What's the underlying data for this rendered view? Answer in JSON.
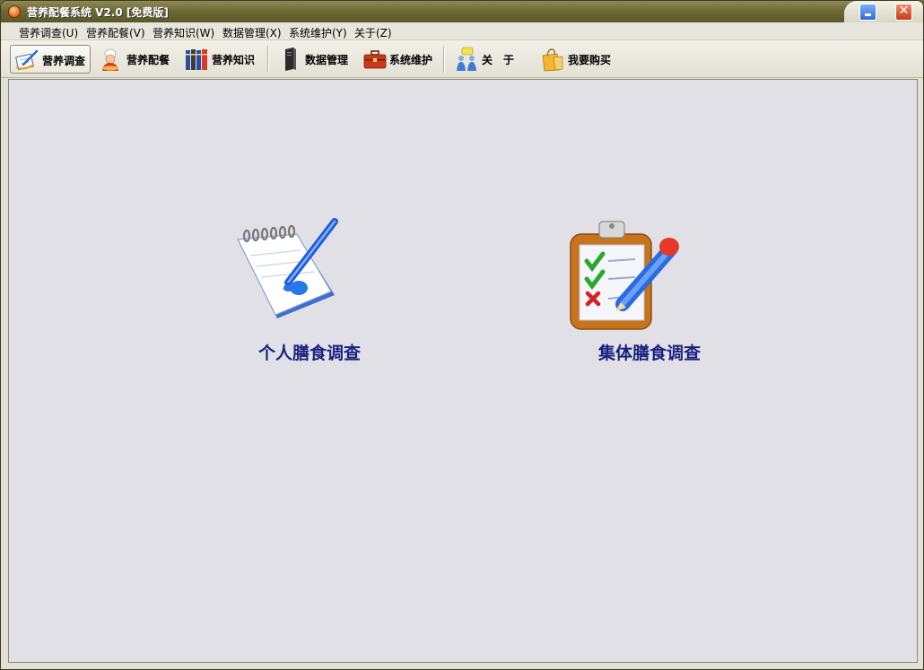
{
  "window": {
    "title": "营养配餐系统 V2.0 [免费版]"
  },
  "menubar": {
    "items": [
      {
        "label": "营养调查(U)"
      },
      {
        "label": "营养配餐(V)"
      },
      {
        "label": "营养知识(W)"
      },
      {
        "label": "数据管理(X)"
      },
      {
        "label": "系统维护(Y)"
      },
      {
        "label": "关于(Z)"
      }
    ]
  },
  "toolbar": {
    "buttons": [
      {
        "label": "营养调查",
        "icon": "survey-icon",
        "active": true
      },
      {
        "label": "营养配餐",
        "icon": "chef-icon"
      },
      {
        "label": "营养知识",
        "icon": "books-icon"
      },
      {
        "label": "数据管理",
        "icon": "server-icon"
      },
      {
        "label": "系统维护",
        "icon": "toolbox-icon"
      },
      {
        "label": "关　于",
        "icon": "about-icon"
      },
      {
        "label": "我要购买",
        "icon": "shopping-bag-icon"
      }
    ]
  },
  "main": {
    "items": [
      {
        "label": "个人膳食调查",
        "icon": "notepad-pen-icon"
      },
      {
        "label": "集体膳食调查",
        "icon": "clipboard-check-icon"
      }
    ]
  },
  "colors": {
    "titlebar": "#6f6b38",
    "client_bg": "#e1e0e6",
    "item_label": "#1a2280"
  }
}
